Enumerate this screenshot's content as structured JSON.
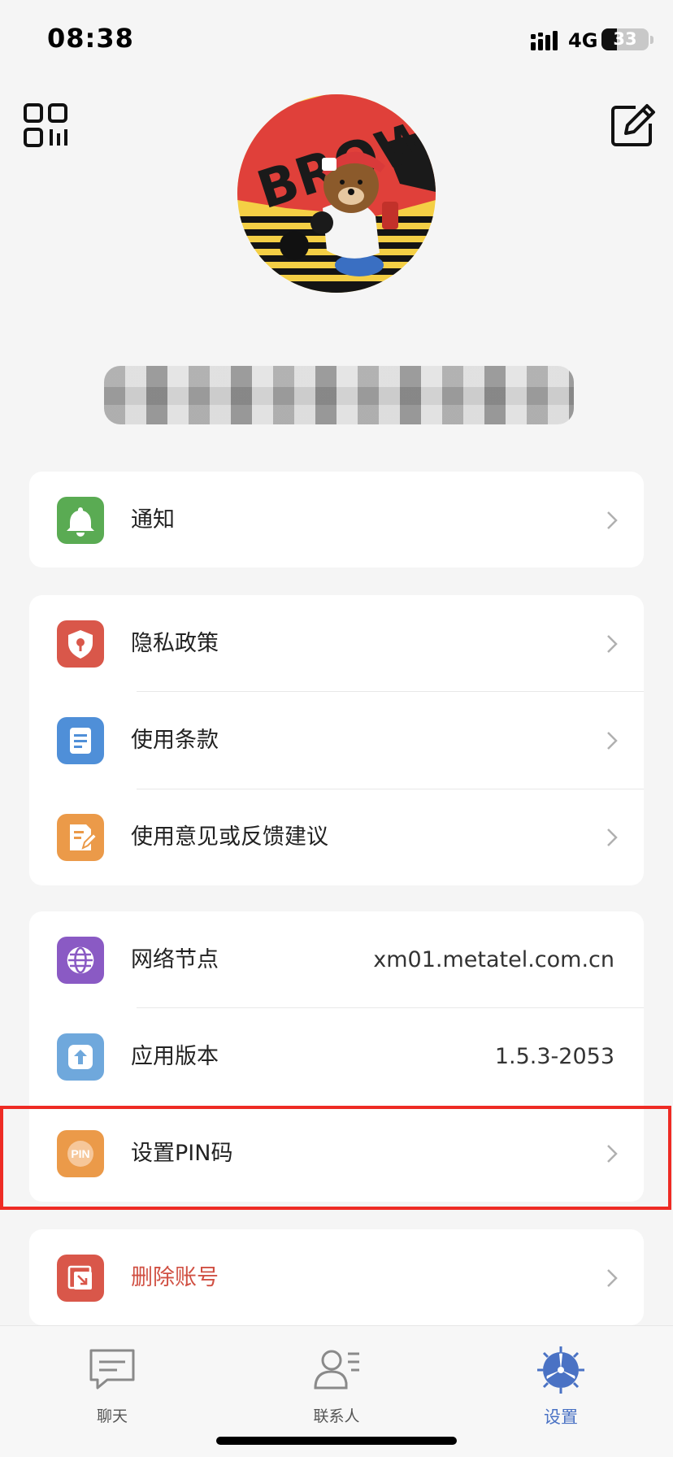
{
  "status_bar": {
    "time": "08:38",
    "network": "4G",
    "battery": "33",
    "battery_level": 0.33,
    "signal_icon": "signal-bars-icon"
  },
  "header": {
    "qr_icon": "qr-code-icon",
    "edit_icon": "edit-icon"
  },
  "profile": {
    "avatar_text": "BROWN",
    "username": ""
  },
  "sections": [
    {
      "items": [
        {
          "label": "通知",
          "icon": "bell-icon",
          "icon_color": "#5aab53"
        }
      ]
    },
    {
      "items": [
        {
          "label": "隐私政策",
          "icon": "shield-icon",
          "icon_color": "#d9574a"
        },
        {
          "label": "使用条款",
          "icon": "document-icon",
          "icon_color": "#4f8fd8"
        },
        {
          "label": "使用意见或反馈建议",
          "icon": "feedback-icon",
          "icon_color": "#eb9a49"
        }
      ]
    },
    {
      "items": [
        {
          "label": "网络节点",
          "value": "xm01.metatel.com.cn",
          "icon": "globe-icon",
          "icon_color": "#8a5ac4"
        },
        {
          "label": "应用版本",
          "value": "1.5.3-2053",
          "icon": "upload-icon",
          "icon_color": "#6fa8dc"
        },
        {
          "label": "设置PIN码",
          "icon": "pin-icon",
          "icon_color": "#eb9a49",
          "icon_text": "PIN"
        }
      ]
    },
    {
      "items": [
        {
          "label": "删除账号",
          "icon": "delete-account-icon",
          "icon_color": "#d9574a"
        }
      ]
    }
  ],
  "tab_bar": {
    "tabs": [
      {
        "label": "聊天",
        "icon": "chat-icon",
        "active": false
      },
      {
        "label": "联系人",
        "icon": "contacts-icon",
        "active": false
      },
      {
        "label": "设置",
        "icon": "settings-icon",
        "active": true
      }
    ]
  },
  "colors": {
    "accent": "#4a72c4",
    "danger": "#d05043",
    "highlight": "#ee2b24"
  }
}
